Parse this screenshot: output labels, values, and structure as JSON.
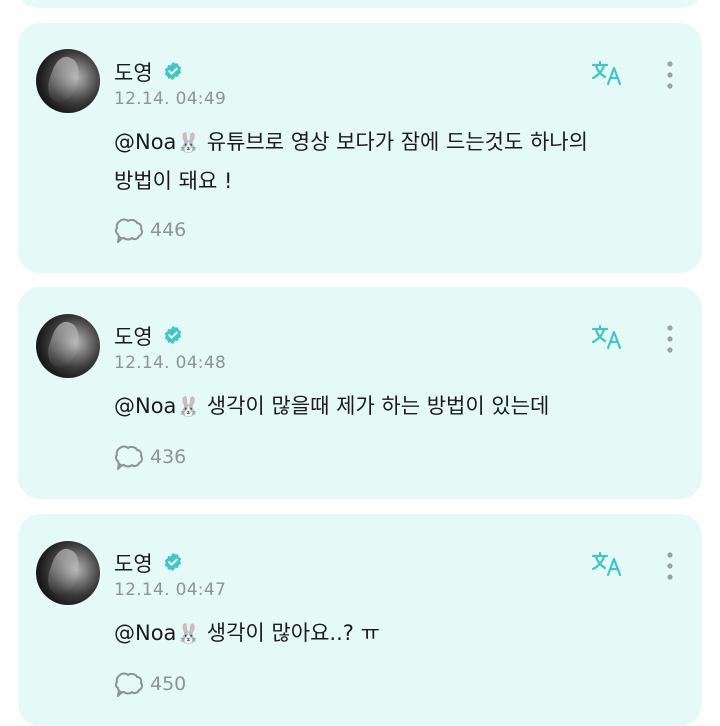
{
  "comments": [
    {
      "author": "도영",
      "time": "12.14. 04:49",
      "mention": "@Noa",
      "mention_emoji": "🐰",
      "text_line1": "유튜브로 영상 보다가 잠에 드는것도 하나의",
      "text_line2": "방법이 돼요 !",
      "reply_count": "446"
    },
    {
      "author": "도영",
      "time": "12.14. 04:48",
      "mention": "@Noa",
      "mention_emoji": "🐰",
      "text_line1": "생각이 많을때 제가 하는 방법이 있는데",
      "reply_count": "436"
    },
    {
      "author": "도영",
      "time": "12.14. 04:47",
      "mention": "@Noa",
      "mention_emoji": "🐰",
      "text_line1": "생각이 많아요..? ㅠ",
      "reply_count": "450"
    }
  ],
  "icons": {
    "verified": "verified-badge-icon",
    "translate": "translate-icon",
    "more": "more-vertical-icon",
    "reply": "reply-bubble-icon"
  },
  "colors": {
    "card_background": "#e5faf7",
    "verified": "#3ec6c9",
    "secondary_text": "#8d9494"
  }
}
